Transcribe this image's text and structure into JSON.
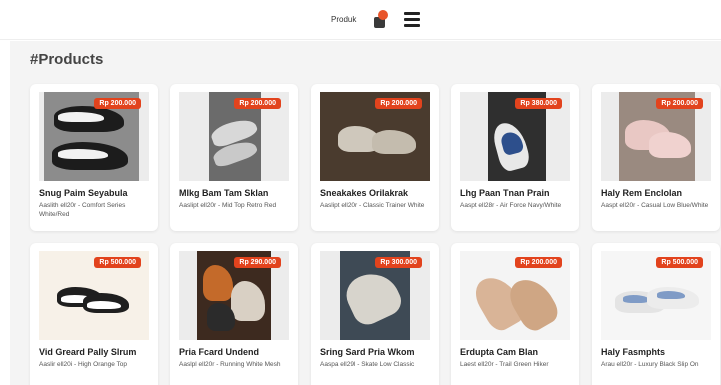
{
  "header": {
    "nav_label": "Produk"
  },
  "section": {
    "title": "#Products"
  },
  "products": [
    {
      "name": "Snug Paim Seyabula",
      "desc": "Aaslith ell20r - Comfort Series White/Red",
      "price": "Rp 200.000"
    },
    {
      "name": "Mlkg Bam Tam Sklan",
      "desc": "Aaslipt ell20r - Mid Top Retro Red",
      "price": "Rp 200.000"
    },
    {
      "name": "Sneakakes Orilakrak",
      "desc": "Aaslipt ell20r - Classic Trainer White",
      "price": "Rp 200.000"
    },
    {
      "name": "Lhg Paan Tnan Prain",
      "desc": "Aaspt ell28r - Air Force Navy/White",
      "price": "Rp 380.000"
    },
    {
      "name": "Haly Rem Enclolan",
      "desc": "Aaspt ell20r - Casual Low Blue/White",
      "price": "Rp 200.000"
    },
    {
      "name": "Vid Greard Pally Slrum",
      "desc": "Aaslir ell20i - High Orange Top",
      "price": "Rp 500.000"
    },
    {
      "name": "Pria Fcard Undend",
      "desc": "Aaslpl ell20r - Running White Mesh",
      "price": "Rp 290.000"
    },
    {
      "name": "Sring Sard Pria Wkom",
      "desc": "Aaspa ell29l - Skate Low Classic",
      "price": "Rp 300.000"
    },
    {
      "name": "Erdupta Cam Blan",
      "desc": "Laest ell20r - Trail Green Hiker",
      "price": "Rp 200.000"
    },
    {
      "name": "Haly Fasmphts",
      "desc": "Arau ell20r - Luxury Black Slip On",
      "price": "Rp 500.000"
    }
  ]
}
